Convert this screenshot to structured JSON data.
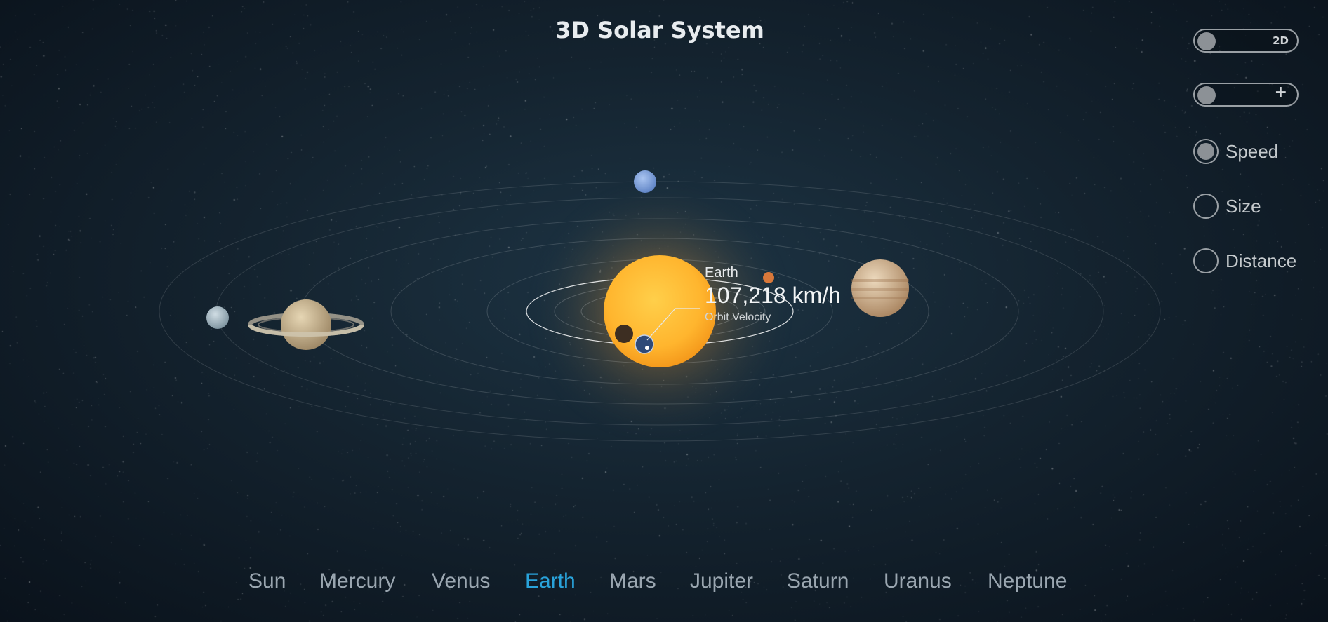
{
  "title": "3D Solar System",
  "controls": {
    "view_toggle_label": "2D",
    "zoom_toggle_label": "+",
    "modes": [
      {
        "label": "Speed",
        "checked": true
      },
      {
        "label": "Size",
        "checked": false
      },
      {
        "label": "Distance",
        "checked": false
      }
    ]
  },
  "info": {
    "planet": "Earth",
    "value": "107,218 km/h",
    "metric": "Orbit Velocity"
  },
  "nav": {
    "items": [
      "Sun",
      "Mercury",
      "Venus",
      "Earth",
      "Mars",
      "Jupiter",
      "Saturn",
      "Uranus",
      "Neptune"
    ],
    "active": "Earth"
  },
  "colors": {
    "accent": "#29a3db",
    "sun": "#ffb52e",
    "earth": "#2f4a78",
    "mars": "#d9783a",
    "neptune": "#7fa3e0",
    "uranus": "#a9bcc8",
    "saturn": "#cdb892",
    "jupiter": "#d8c0a0"
  }
}
